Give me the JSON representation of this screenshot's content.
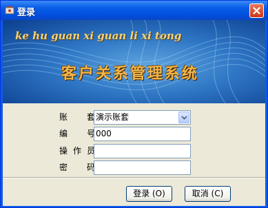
{
  "window": {
    "title": "登录",
    "icon": "app-icon",
    "close_icon": "close-icon"
  },
  "banner": {
    "pinyin": "ke hu guan xi guan li xi tong",
    "title": "客户关系管理系统"
  },
  "form": {
    "account": {
      "label": "账  套",
      "value": "演示账套"
    },
    "code": {
      "label": "编  号",
      "value": "000"
    },
    "operator": {
      "label": "操作员",
      "value": ""
    },
    "password": {
      "label": "密  码",
      "value": ""
    }
  },
  "buttons": {
    "login": "登录 (O)",
    "cancel": "取消 (C)"
  },
  "colors": {
    "titlebar": "#0A5FE6",
    "banner_text": "#F3B64B",
    "dialog_bg": "#ECE9D8"
  }
}
